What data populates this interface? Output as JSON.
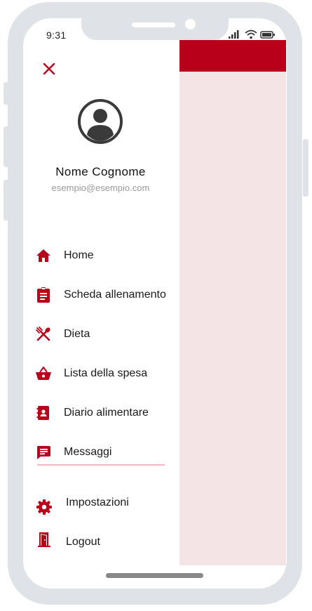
{
  "status_bar": {
    "time": "9:31"
  },
  "user": {
    "name": "Nome Cognome",
    "email": "esempio@esempio.com"
  },
  "menu": {
    "items": [
      {
        "label": "Home",
        "icon": "home-icon"
      },
      {
        "label": "Scheda allenamento",
        "icon": "clipboard-icon"
      },
      {
        "label": "Dieta",
        "icon": "utensils-icon"
      },
      {
        "label": "Lista della spesa",
        "icon": "basket-icon"
      },
      {
        "label": "Diario alimentare",
        "icon": "contact-book-icon"
      },
      {
        "label": "Messaggi",
        "icon": "message-icon"
      }
    ],
    "footer": [
      {
        "label": "Impostazioni",
        "icon": "gear-icon"
      },
      {
        "label": "Logout",
        "icon": "door-icon"
      }
    ]
  },
  "colors": {
    "accent": "#b8001a",
    "overlay": "#f5e4e6",
    "divider": "#f2b8bf"
  }
}
